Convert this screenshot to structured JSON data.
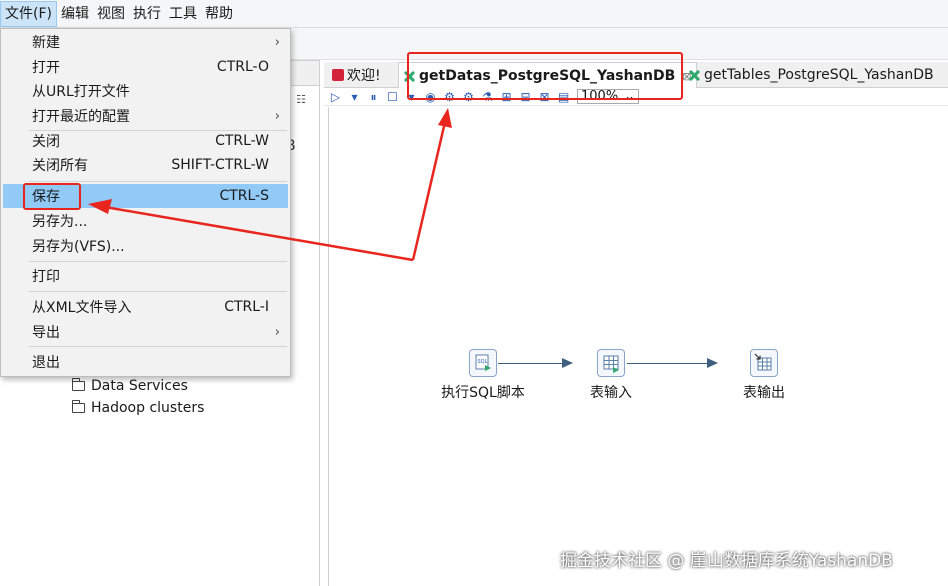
{
  "menubar": {
    "items": [
      "文件(F)",
      "编辑",
      "视图",
      "执行",
      "工具",
      "帮助"
    ]
  },
  "file_menu": {
    "items": [
      {
        "label": "新建",
        "shortcut": "",
        "submenu": true
      },
      {
        "label": "打开",
        "shortcut": "CTRL-O",
        "submenu": false
      },
      {
        "label": "从URL打开文件",
        "shortcut": "",
        "submenu": false
      },
      {
        "label": "打开最近的配置",
        "shortcut": "",
        "submenu": true
      },
      {
        "label": "关闭",
        "shortcut": "CTRL-W",
        "submenu": false
      },
      {
        "label": "关闭所有",
        "shortcut": "SHIFT-CTRL-W",
        "submenu": false
      },
      {
        "label": "保存",
        "shortcut": "CTRL-S",
        "submenu": false,
        "highlighted": true
      },
      {
        "label": "另存为...",
        "shortcut": "",
        "submenu": false
      },
      {
        "label": "另存为(VFS)...",
        "shortcut": "",
        "submenu": false
      },
      {
        "label": "打印",
        "shortcut": "",
        "submenu": false
      },
      {
        "label": "从XML文件导入",
        "shortcut": "CTRL-I",
        "submenu": false
      },
      {
        "label": "导出",
        "shortcut": "",
        "submenu": true
      },
      {
        "label": "退出",
        "shortcut": "",
        "submenu": false
      }
    ],
    "submenu_glyph": "›"
  },
  "left_panel": {
    "partial_text": "B",
    "view_button": "☷",
    "tree": [
      "Data Services",
      "Hadoop clusters"
    ]
  },
  "editor": {
    "tabs": [
      {
        "label": "欢迎!",
        "icon": "welcome-icon",
        "active": false
      },
      {
        "label": "getDatas_PostgreSQL_YashanDB",
        "icon": "transformation-icon",
        "active": true,
        "close": "⊠"
      },
      {
        "label": "getTables_PostgreSQL_YashanDB",
        "icon": "transformation-icon",
        "active": false
      }
    ],
    "toolbar": {
      "glyphs": [
        "▷",
        "▾",
        "⏸",
        "☐",
        "▾",
        "◉",
        "⚙",
        "⚙",
        "⚗",
        "⊞",
        "⊟",
        "⊠",
        "▤"
      ],
      "zoom": "100%",
      "zoom_arrow": "⌄"
    }
  },
  "canvas": {
    "steps": [
      {
        "label": "执行SQL脚本",
        "icon": "sql-script-icon"
      },
      {
        "label": "表输入",
        "icon": "table-input-icon"
      },
      {
        "label": "表输出",
        "icon": "table-output-icon"
      }
    ]
  },
  "watermark": "掘金技术社区 @ 崖山数据库系统YashanDB",
  "colors": {
    "annotation": "#e8261e",
    "menu_highlight": "#91c9f7",
    "hop": "#3f5f7f",
    "transformation_icon": "#2ea86b"
  }
}
